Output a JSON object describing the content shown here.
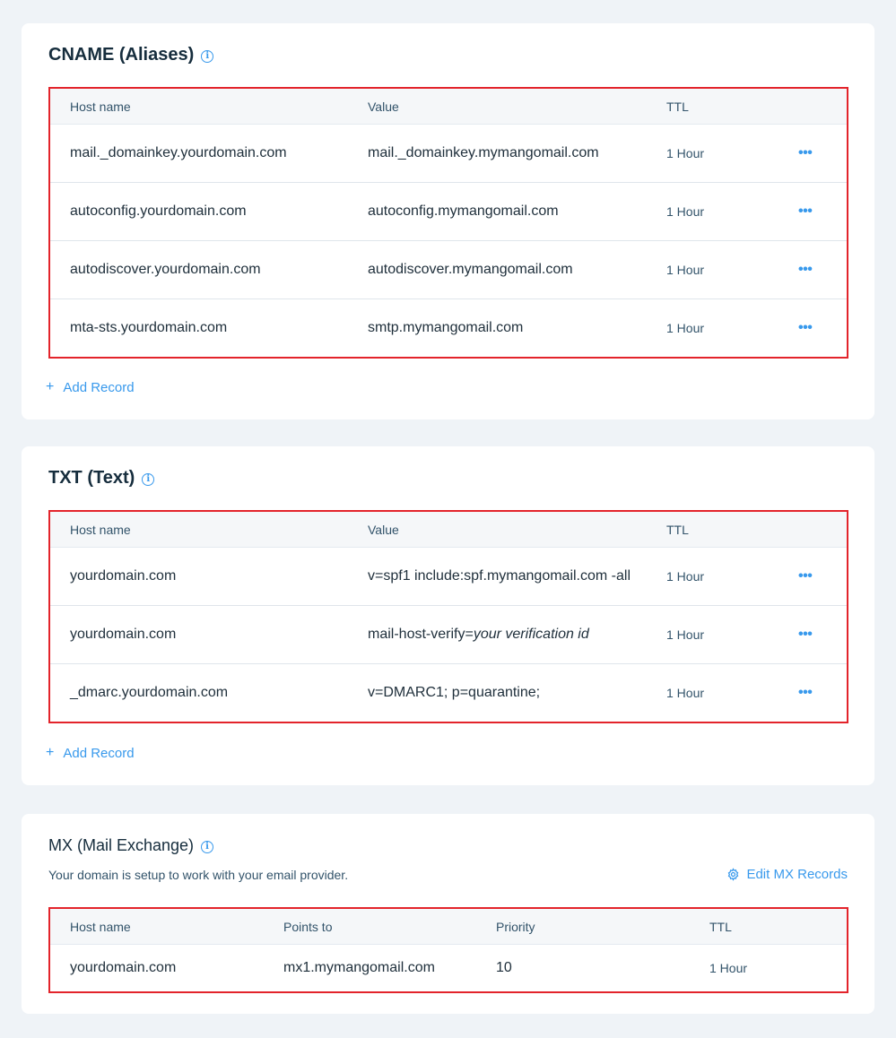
{
  "cname": {
    "title": "CNAME (Aliases)",
    "headers": {
      "host": "Host name",
      "value": "Value",
      "ttl": "TTL"
    },
    "rows": [
      {
        "host": "mail._domainkey.yourdomain.com",
        "value": "mail._domainkey.mymangomail.com",
        "ttl": "1 Hour"
      },
      {
        "host": "autoconfig.yourdomain.com",
        "value": "autoconfig.mymangomail.com",
        "ttl": "1 Hour"
      },
      {
        "host": "autodiscover.yourdomain.com",
        "value": "autodiscover.mymangomail.com",
        "ttl": "1 Hour"
      },
      {
        "host": "mta-sts.yourdomain.com",
        "value": "smtp.mymangomail.com",
        "ttl": "1 Hour"
      }
    ],
    "add_label": "Add Record"
  },
  "txt": {
    "title": "TXT (Text)",
    "headers": {
      "host": "Host name",
      "value": "Value",
      "ttl": "TTL"
    },
    "rows": [
      {
        "host": "yourdomain.com",
        "value": "v=spf1 include:spf.mymangomail.com -all",
        "ttl": "1 Hour"
      },
      {
        "host": "yourdomain.com",
        "value_prefix": "mail-host-verify=",
        "value_italic": "your verification id",
        "ttl": "1 Hour"
      },
      {
        "host": "_dmarc.yourdomain.com",
        "value": "v=DMARC1; p=quarantine;",
        "ttl": "1 Hour"
      }
    ],
    "add_label": "Add Record"
  },
  "mx": {
    "title": "MX (Mail Exchange)",
    "description": "Your domain is setup to work with your email provider.",
    "edit_label": "Edit MX Records",
    "headers": {
      "host": "Host name",
      "points_to": "Points to",
      "priority": "Priority",
      "ttl": "TTL"
    },
    "rows": [
      {
        "host": "yourdomain.com",
        "points_to": "mx1.mymangomail.com",
        "priority": "10",
        "ttl": "1 Hour"
      }
    ]
  },
  "icons": {
    "info": "info-icon",
    "more": "more-horizontal-icon",
    "plus": "plus-icon",
    "gear": "gear-icon",
    "more_glyph": "•••",
    "plus_glyph": "+",
    "info_glyph": "i"
  },
  "colors": {
    "accent": "#3899ec",
    "highlight_border": "#e3242b",
    "page_bg": "#eff3f7"
  }
}
